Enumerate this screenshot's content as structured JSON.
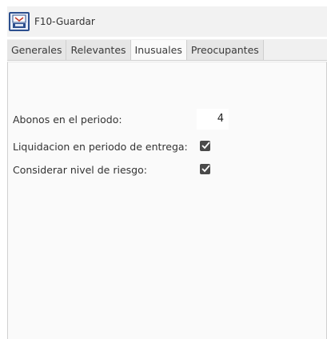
{
  "toolbar": {
    "save_label": "F10-Guardar",
    "save_icon": "save-icon"
  },
  "tabs": [
    {
      "label": "Generales",
      "active": false
    },
    {
      "label": "Relevantes",
      "active": false
    },
    {
      "label": "Inusuales",
      "active": true
    },
    {
      "label": "Preocupantes",
      "active": false
    }
  ],
  "form": {
    "abonos_label": "Abonos en el periodo:",
    "abonos_value": "4",
    "liquidacion_label": "Liquidacion en periodo de entrega:",
    "liquidacion_checked": true,
    "riesgo_label": "Considerar nivel de riesgo:",
    "riesgo_checked": true
  }
}
